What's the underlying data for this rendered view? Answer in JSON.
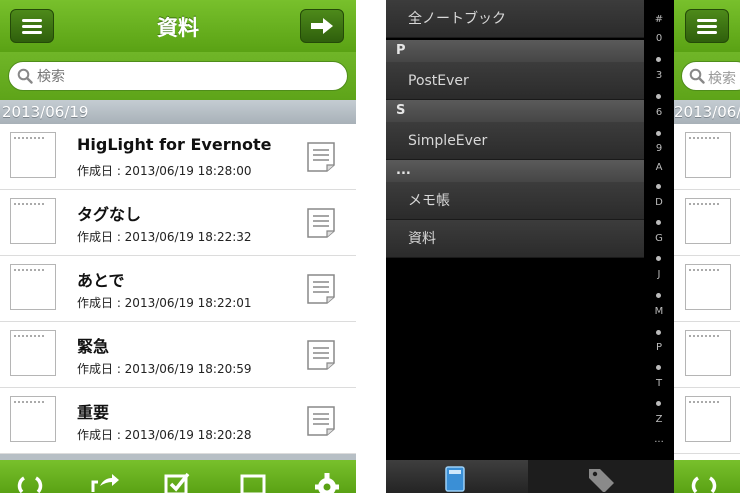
{
  "left": {
    "title": "資料",
    "search_placeholder": "検索",
    "section_date": "2013/06/19",
    "notes": [
      {
        "title": "HigLight for Evernote",
        "date": "作成日 : 2013/06/19 18:28:00"
      },
      {
        "title": "タグなし",
        "date": "作成日 : 2013/06/19 18:22:32"
      },
      {
        "title": "あとで",
        "date": "作成日 : 2013/06/19 18:22:01"
      },
      {
        "title": "緊急",
        "date": "作成日 : 2013/06/19 18:20:59"
      },
      {
        "title": "重要",
        "date": "作成日 : 2013/06/19 18:20:28"
      }
    ]
  },
  "right": {
    "menu": {
      "all_notebooks": "全ノートブック",
      "hdr_p": "P",
      "item_postever": "PostEver",
      "hdr_s": "S",
      "item_simpleever": "SimpleEver",
      "hdr_other": "...",
      "item_memo": "メモ帳",
      "item_shiryo": "資料"
    },
    "index": [
      "#",
      "0",
      "3",
      "6",
      "9",
      "A",
      "D",
      "G",
      "J",
      "M",
      "P",
      "T",
      "Z",
      "..."
    ],
    "peek_search": "検索",
    "peek_date": "2013/06/19"
  },
  "colors": {
    "green_top": "#78c02c",
    "green_bottom": "#5aa214",
    "dark_btn": "#2f5f0c",
    "menu_bg": "#2b2b2b"
  }
}
